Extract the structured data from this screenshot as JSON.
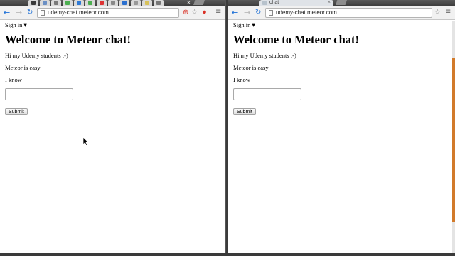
{
  "left_window": {
    "address": "udemy-chat.meteor.com",
    "tab_close": "×"
  },
  "right_window": {
    "tab_title": "chat",
    "tab_close": "×",
    "address": "udemy-chat.meteor.com"
  },
  "icons": {
    "back": "back-arrow-icon",
    "forward": "forward-arrow-icon",
    "reload": "reload-icon",
    "menu": "hamburger-menu-icon",
    "star": "star-icon"
  },
  "glyphs": {
    "back": "←",
    "forward": "→",
    "reload": "↻",
    "menu": "≡",
    "star": "☆",
    "ext_plus": "⊕",
    "ext_stop": "⏺"
  },
  "page": {
    "signin_label": "Sign in ▾",
    "title": "Welcome to Meteor chat!",
    "messages": [
      "Hi my Udemy students :-)",
      "Meteor is easy",
      "I know"
    ],
    "input_value": "",
    "submit_label": "Submit"
  },
  "colors": {
    "accent_blue": "#1c6fd6",
    "scrollbar_thumb": "#d27a2a",
    "ext_red": "#d93025"
  }
}
